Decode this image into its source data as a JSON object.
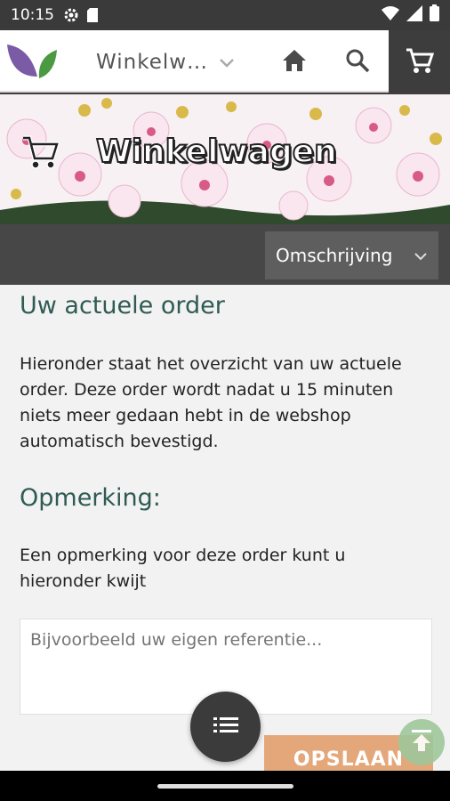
{
  "status_bar": {
    "time": "10:15",
    "icons": [
      "gear-icon",
      "sd-card-icon",
      "wifi-icon",
      "signal-icon",
      "battery-icon"
    ]
  },
  "app_bar": {
    "shop_select": {
      "value": "Winkelw…"
    },
    "icons": [
      "logo",
      "chevron-down-icon",
      "home-icon",
      "search-icon",
      "cart-icon"
    ]
  },
  "banner": {
    "title": "Winkelwagen",
    "icon": "cart-icon"
  },
  "toolbar": {
    "sort_select": {
      "value": "Omschrijving"
    }
  },
  "order_section": {
    "heading": "Uw actuele order",
    "text": "Hieronder staat het overzicht van uw actuele order. Deze order wordt nadat u 15 minuten niets meer gedaan hebt in de webshop automatisch bevestigd."
  },
  "remark_section": {
    "heading": "Opmerking:",
    "text": "Een opmerking voor deze order kunt u hieronder kwijt",
    "input": {
      "placeholder": "Bijvoorbeeld uw eigen referentie..."
    }
  },
  "actions": {
    "save_label": "OPSLAAN",
    "fab_icon": "list-icon",
    "scroll_top_icon": "scroll-to-top-icon"
  },
  "colors": {
    "accent_green": "#2f5b52",
    "save_button": "#e4a77a",
    "dark_bar": "#474747",
    "top_button": "#9fc79b"
  }
}
